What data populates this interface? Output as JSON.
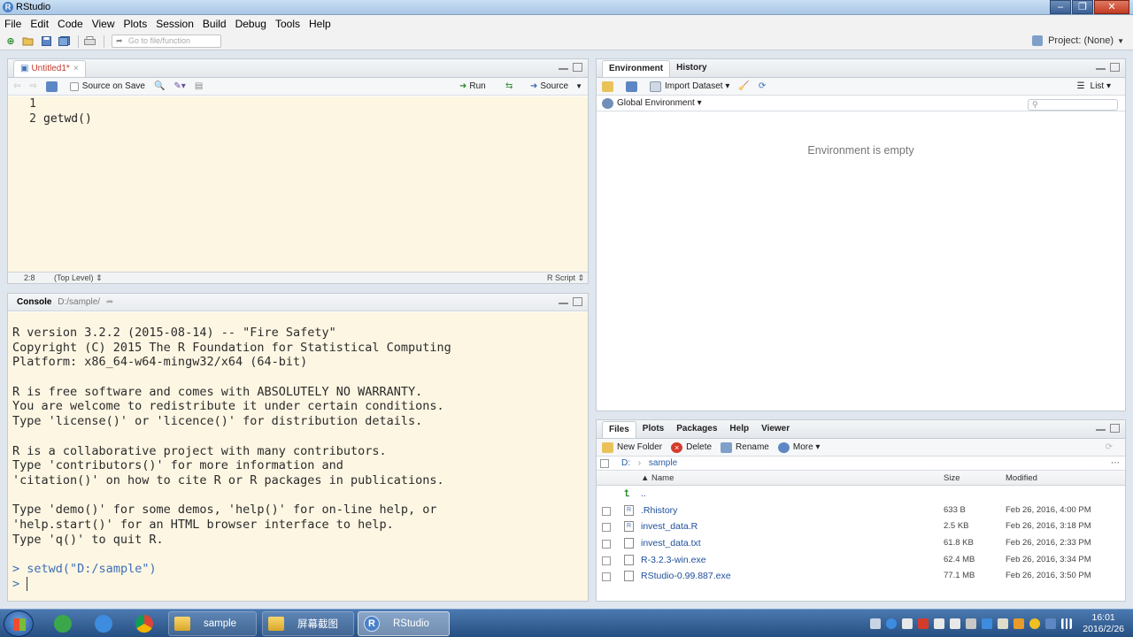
{
  "window": {
    "title": "RStudio",
    "min": "–",
    "max": "❐",
    "close": "✕"
  },
  "menu": [
    "File",
    "Edit",
    "Code",
    "View",
    "Plots",
    "Session",
    "Build",
    "Debug",
    "Tools",
    "Help"
  ],
  "toolbar": {
    "goto_placeholder": "Go to file/function",
    "project": "Project: (None)"
  },
  "editor": {
    "tab": "Untitled1*",
    "source_on_save": "Source on Save",
    "run": "Run",
    "source": "Source",
    "line_numbers": [
      "1",
      "2"
    ],
    "lines": [
      "",
      "getwd()"
    ],
    "status_pos": "2:8",
    "status_scope": "(Top Level) ⇕",
    "status_type": "R Script ⇕"
  },
  "console": {
    "title": "Console",
    "path": "D:/sample/",
    "lines": [
      "R version 3.2.2 (2015-08-14) -- \"Fire Safety\"",
      "Copyright (C) 2015 The R Foundation for Statistical Computing",
      "Platform: x86_64-w64-mingw32/x64 (64-bit)",
      "",
      "R is free software and comes with ABSOLUTELY NO WARRANTY.",
      "You are welcome to redistribute it under certain conditions.",
      "Type 'license()' or 'licence()' for distribution details.",
      "",
      "R is a collaborative project with many contributors.",
      "Type 'contributors()' for more information and",
      "'citation()' on how to cite R or R packages in publications.",
      "",
      "Type 'demo()' for some demos, 'help()' for on-line help, or",
      "'help.start()' for an HTML browser interface to help.",
      "Type 'q()' to quit R.",
      ""
    ],
    "command_prompt": ">",
    "command": "setwd(\"D:/sample\")",
    "input_prompt": ">"
  },
  "env_pane": {
    "tabs": [
      "Environment",
      "History"
    ],
    "import_dataset": "Import Dataset ▾",
    "list": "List ▾",
    "scope": "Global Environment ▾",
    "empty_message": "Environment is empty"
  },
  "files_pane": {
    "tabs": [
      "Files",
      "Plots",
      "Packages",
      "Help",
      "Viewer"
    ],
    "new_folder": "New Folder",
    "delete": "Delete",
    "rename": "Rename",
    "more": "More ▾",
    "crumb_root": "D:",
    "crumb_sep": "›",
    "crumb_dir": "sample",
    "col_name": "▲ Name",
    "col_size": "Size",
    "col_modified": "Modified",
    "parent_dir": "..",
    "files": [
      {
        "name": ".Rhistory",
        "size": "633 B",
        "modified": "Feb 26, 2016, 4:00 PM"
      },
      {
        "name": "invest_data.R",
        "size": "2.5 KB",
        "modified": "Feb 26, 2016, 3:18 PM"
      },
      {
        "name": "invest_data.txt",
        "size": "61.8 KB",
        "modified": "Feb 26, 2016, 2:33 PM"
      },
      {
        "name": "R-3.2.3-win.exe",
        "size": "62.4 MB",
        "modified": "Feb 26, 2016, 3:34 PM"
      },
      {
        "name": "RStudio-0.99.887.exe",
        "size": "77.1 MB",
        "modified": "Feb 26, 2016, 3:50 PM"
      }
    ]
  },
  "taskbar": {
    "tasks": [
      "sample",
      "屏幕截图",
      "RStudio"
    ],
    "time": "16:01",
    "date": "2016/2/26"
  }
}
